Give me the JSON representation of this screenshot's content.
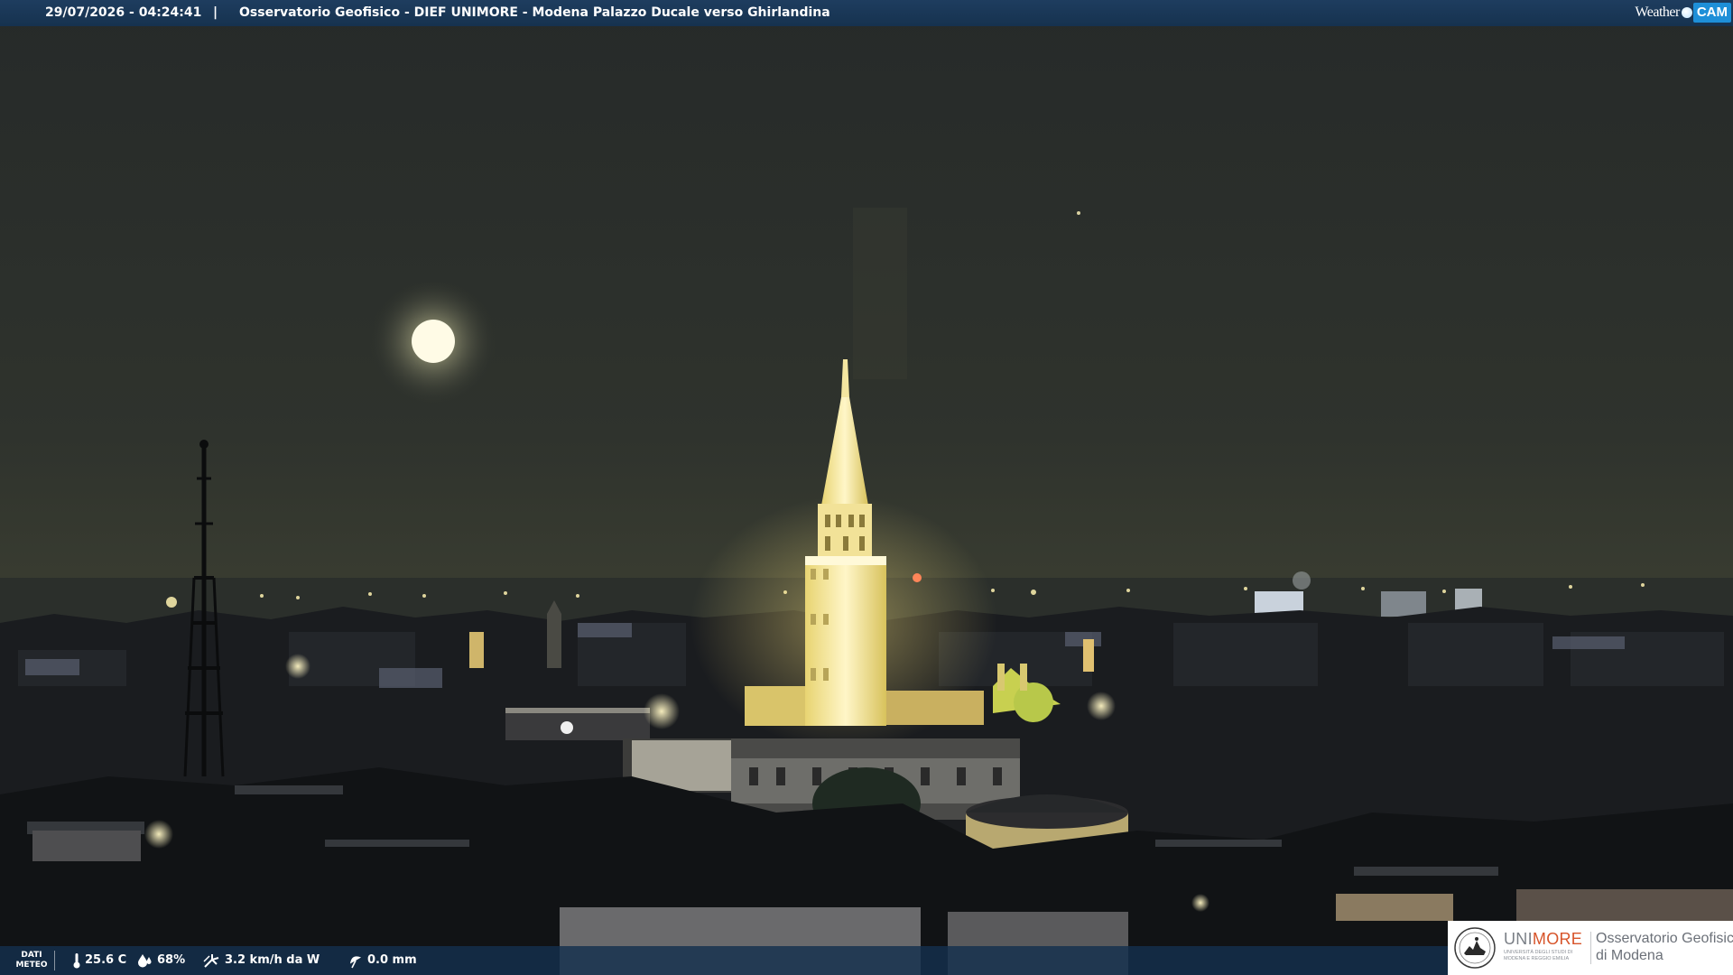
{
  "header": {
    "timestamp": "29/07/2026 - 04:24:41",
    "separator": "|",
    "caption": "Osservatorio Geofisico - DIEF UNIMORE - Modena Palazzo Ducale verso Ghirlandina",
    "brand_part1": "Weather",
    "brand_part2": "CAM"
  },
  "weather_bar": {
    "section_label_line1": "DATI",
    "section_label_line2": "METEO",
    "temperature": "25.6 C",
    "humidity": "68%",
    "wind": "3.2 km/h da W",
    "rain": "0.0 mm"
  },
  "logo": {
    "uni_part1": "UNI",
    "uni_part2": "MORE",
    "uni_subtitle": "Università degli studi di Modena e Reggio Emilia",
    "observatory_line1": "Osservatorio Geofisico",
    "observatory_line2": "di Modena"
  },
  "icons": {
    "temperature": "thermometer-icon",
    "humidity": "droplet-icon",
    "wind": "wind-icon",
    "rain": "umbrella-icon"
  },
  "colors": {
    "banner": "#16324f",
    "sky": "#30342e",
    "tower_light": "#fff4b8",
    "moon": "#fffbe0",
    "brand_cam": "#1e8fd8",
    "unimore_accent": "#d7542a"
  }
}
